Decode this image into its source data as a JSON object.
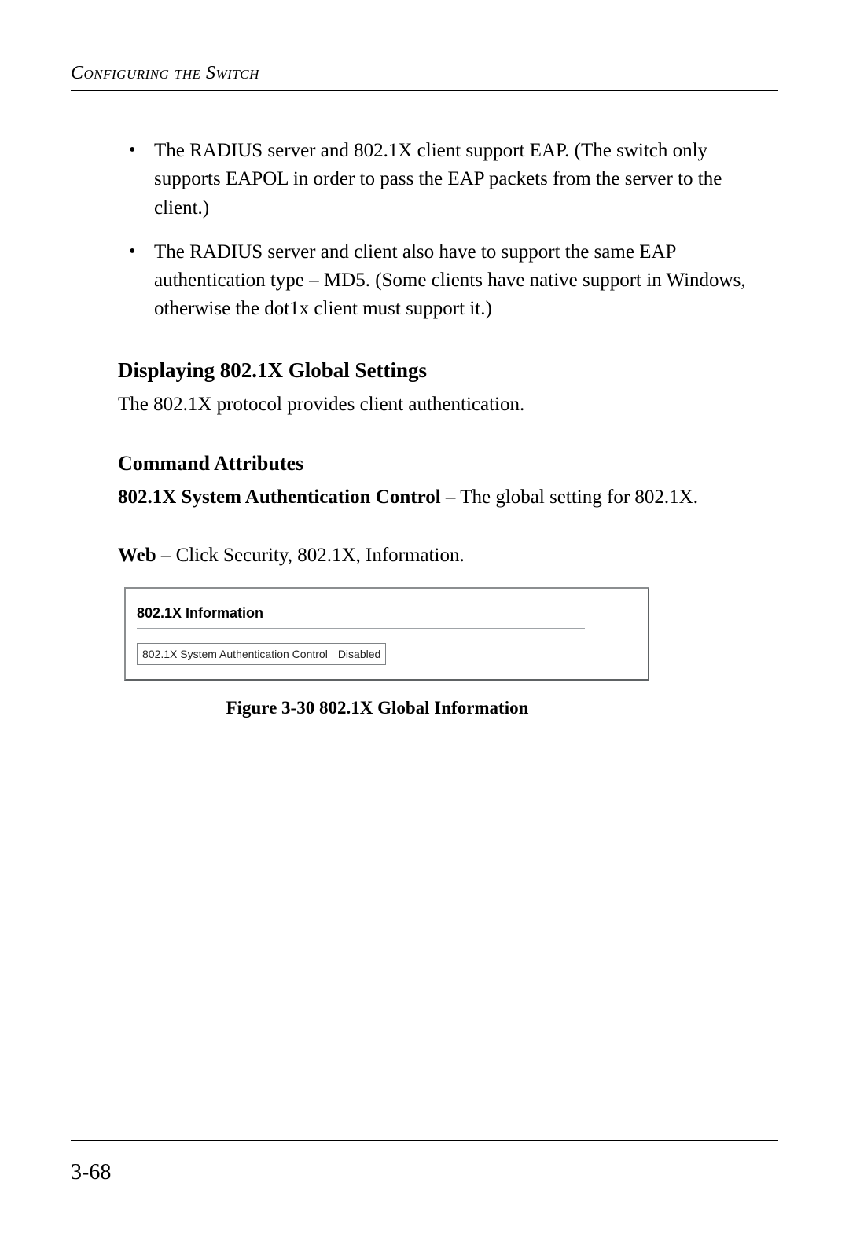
{
  "header": {
    "running_head": "Configuring the Switch"
  },
  "bullets": [
    "The RADIUS server and 802.1X client support EAP. (The switch only supports EAPOL in order to pass the EAP packets from the server to the client.)",
    "The RADIUS server and client also have to support the same EAP authentication type – MD5. (Some clients have native support in Windows, otherwise the dot1x client must support it.)"
  ],
  "section": {
    "heading": "Displaying 802.1X Global Settings",
    "intro": "The 802.1X protocol provides client authentication."
  },
  "command_attributes": {
    "heading": "Command Attributes",
    "attr_bold": "802.1X System Authentication Control",
    "attr_rest": " – The global setting for 802.1X."
  },
  "web_line": {
    "label": "Web",
    "rest": " – Click Security, 802.1X, Information."
  },
  "screenshot": {
    "panel_title": "802.1X Information",
    "row_label": "802.1X System Authentication Control",
    "row_value": "Disabled"
  },
  "figure_caption": "Figure 3-30  802.1X Global Information",
  "page_number": "3-68"
}
